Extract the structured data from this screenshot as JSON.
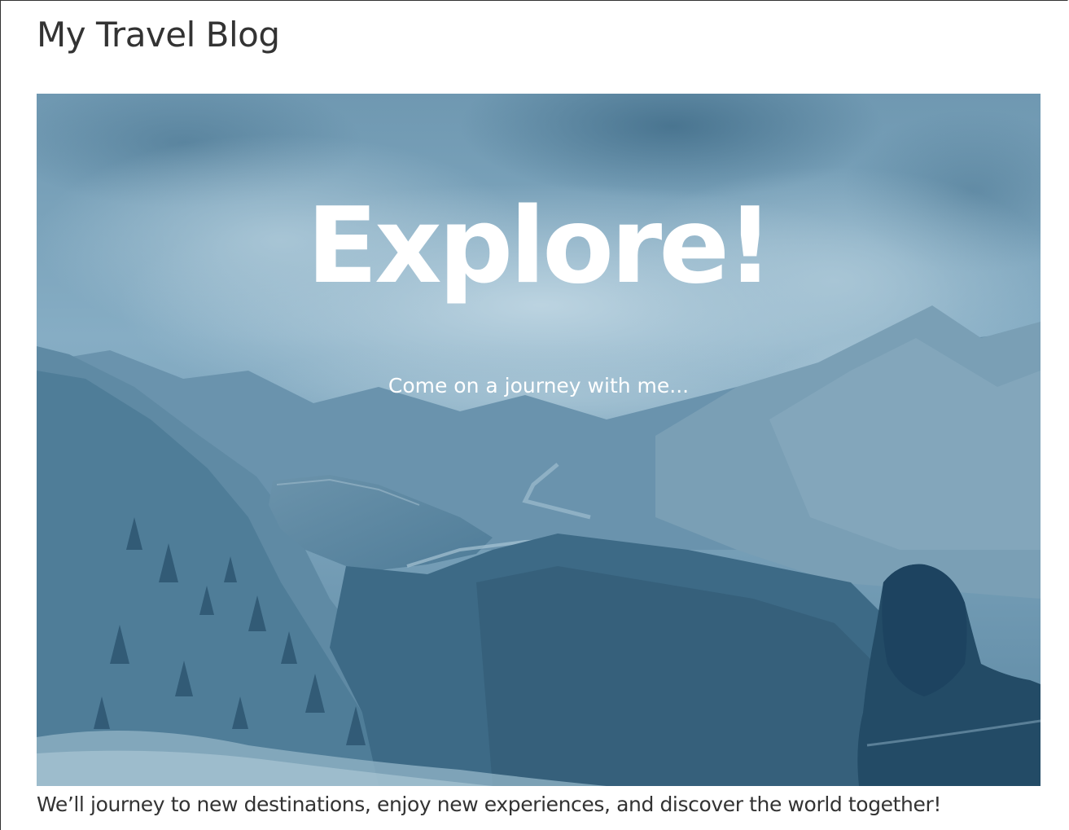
{
  "site": {
    "title": "My Travel Blog"
  },
  "hero": {
    "heading": "Explore!",
    "subheading": "Come on a journey with me...",
    "image": "mountain lake landscape with clouds and a person in the foreground",
    "overlay_color": "#5d8aa6"
  },
  "content": {
    "intro": "We’ll journey to new destinations, enjoy new experiences, and discover the world together!"
  },
  "colors": {
    "text": "#333333",
    "hero_text": "#ffffff"
  }
}
